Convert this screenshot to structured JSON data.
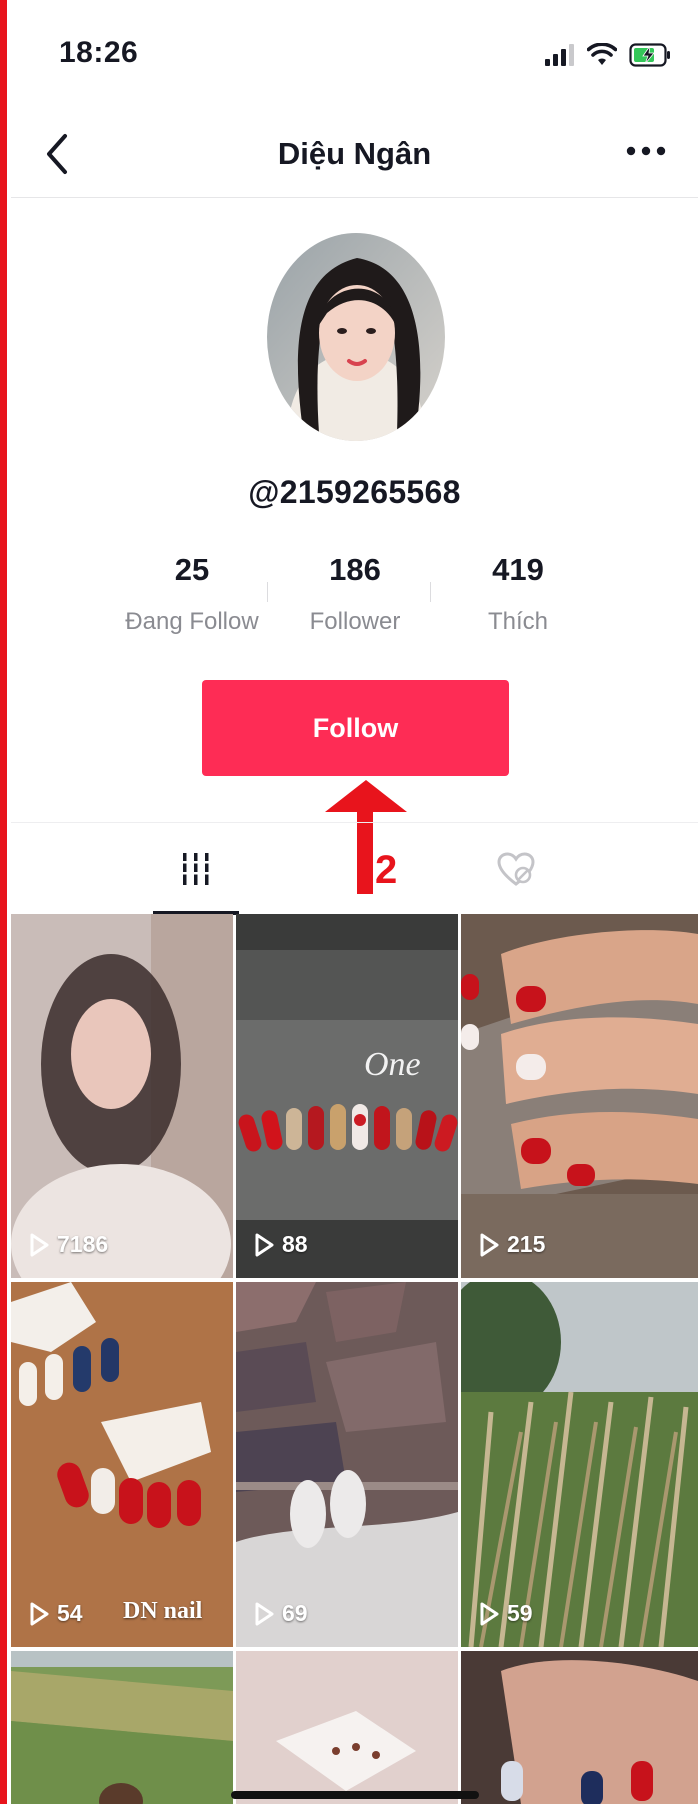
{
  "status_bar": {
    "time": "18:26",
    "icons": [
      "cellular-signal-icon",
      "wifi-icon",
      "battery-charging-icon"
    ]
  },
  "nav": {
    "title": "Diệu Ngân",
    "back_icon": "chevron-left-icon",
    "more_icon": "more-dots-icon"
  },
  "profile": {
    "handle": "@2159265568",
    "stats": [
      {
        "value": "25",
        "label": "Đang Follow"
      },
      {
        "value": "186",
        "label": "Follower"
      },
      {
        "value": "419",
        "label": "Thích"
      }
    ],
    "follow_label": "Follow"
  },
  "annotation": {
    "step_number": "2",
    "color": "#e8141c"
  },
  "tabs": [
    {
      "icon": "videos-grid-icon",
      "active": true
    },
    {
      "icon": "liked-heart-icon",
      "active": false
    }
  ],
  "videos": [
    {
      "views": "7186"
    },
    {
      "views": "88",
      "caption": "One"
    },
    {
      "views": "215"
    },
    {
      "views": "54",
      "watermark": "DN nail"
    },
    {
      "views": "69"
    },
    {
      "views": "59"
    },
    {
      "views": ""
    },
    {
      "views": ""
    },
    {
      "views": ""
    }
  ],
  "colors": {
    "accent": "#fe2c55",
    "text_primary": "#161823",
    "text_secondary": "#8a8b91",
    "annotation_red": "#e8141c"
  }
}
